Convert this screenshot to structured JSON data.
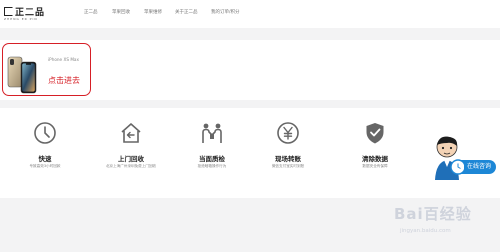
{
  "header": {
    "logo_text": "正二品",
    "logo_sub": "ZHENG ER PIN",
    "nav": [
      "正二品",
      "苹果回收",
      "苹果维修",
      "关于正二品",
      "我的订单/积分"
    ]
  },
  "product": {
    "name": "iPhone XS Max",
    "cta": "点击进去"
  },
  "features": [
    {
      "icon": "clock-icon",
      "title": "快速",
      "desc": "专致高效3小时回款"
    },
    {
      "icon": "home-return-icon",
      "title": "上门回收",
      "desc": "北京上海广州深圳免费上门回收"
    },
    {
      "icon": "inspect-people-icon",
      "title": "当面质检",
      "desc": "拒绝暗箱操作行为"
    },
    {
      "icon": "yen-circle-icon",
      "title": "现场转账",
      "desc": "微信支付宝实时到账"
    },
    {
      "icon": "shield-check-icon",
      "title": "清除数据",
      "desc": "数据安全有保障"
    }
  ],
  "service": {
    "label": "在线咨询"
  },
  "watermark": {
    "text": "Bai百经验",
    "sub": "jingyan.baidu.com"
  },
  "colors": {
    "accent": "#d61f26",
    "service_blue": "#1d87d6",
    "background": "#f3f3f4"
  }
}
